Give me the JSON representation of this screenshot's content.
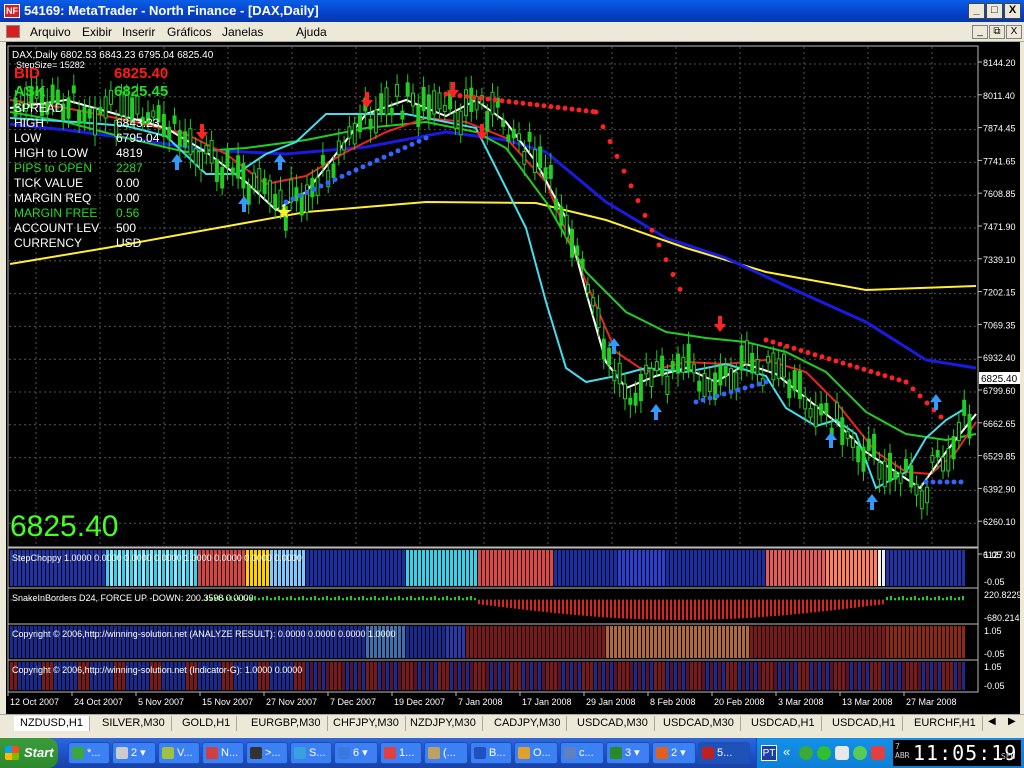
{
  "window": {
    "title": "54169: MetaTrader - North Finance - [DAX,Daily]",
    "app_icon": "NF",
    "controls": [
      "_",
      "□",
      "X"
    ],
    "mdi_controls": [
      "_",
      "⧉",
      "X"
    ]
  },
  "menu": [
    "Arquivo",
    "Exibir",
    "Inserir",
    "Gráficos",
    "Janelas",
    "Ajuda"
  ],
  "chart": {
    "symbol_line": "DAX,Daily  6802.53 6843.23 6795.04 6825.40",
    "stepsize": "StepSize= 15282",
    "current_price_label": "6825.40",
    "big_price": "6825.40",
    "info_panel": [
      {
        "label": "BID",
        "value": "6825.40",
        "color": "#ff1a1a"
      },
      {
        "label": "ASK",
        "value": "6825.45",
        "color": "#22dd22"
      },
      {
        "label": "SPREAD",
        "value": "",
        "color": "#ffffff"
      },
      {
        "label": "HIGH",
        "value": "6843.23",
        "color": "#ffffff"
      },
      {
        "label": "LOW",
        "value": "6795.04",
        "color": "#ffffff"
      },
      {
        "label": "HIGH to LOW",
        "value": "4819",
        "color": "#ffffff"
      },
      {
        "label": "PIPS to OPEN",
        "value": "2287",
        "color": "#22dd22"
      },
      {
        "label": "TICK VALUE",
        "value": "0.00",
        "color": "#ffffff"
      },
      {
        "label": "MARGIN REQ",
        "value": "0.00",
        "color": "#ffffff"
      },
      {
        "label": "MARGIN FREE",
        "value": "0.56",
        "color": "#22dd22"
      },
      {
        "label": "ACCOUNT LEV",
        "value": "500",
        "color": "#ffffff"
      },
      {
        "label": "CURRENCY",
        "value": "USD",
        "color": "#ffffff"
      }
    ],
    "price_axis": [
      "8144.20",
      "8011.40",
      "7874.45",
      "7741.65",
      "7608.85",
      "7471.90",
      "7339.10",
      "7202.15",
      "7069.35",
      "6932.40",
      "6799.60",
      "6662.65",
      "6529.85",
      "6392.90",
      "6260.10",
      "6127.30"
    ],
    "date_axis": [
      "12 Oct 2007",
      "24 Oct 2007",
      "5 Nov 2007",
      "15 Nov 2007",
      "27 Nov 2007",
      "7 Dec 2007",
      "19 Dec 2007",
      "7 Jan 2008",
      "17 Jan 2008",
      "29 Jan 2008",
      "8 Feb 2008",
      "20 Feb 2008",
      "3 Mar 2008",
      "13 Mar 2008",
      "27 Mar 2008"
    ]
  },
  "subwindows": [
    {
      "label": "StepChoppy 1.0000 0.0000 0.0000 0.0000 1.0000 0.0000 0.0000 0.0000",
      "scale_top": "1.05",
      "scale_bottom": "-0.05"
    },
    {
      "label": "SnakeInBorders D24, FORCE UP -DOWN: 200.3598 0.0000",
      "scale_top": "220.8229",
      "scale_bottom": "-680.214"
    },
    {
      "label": "Copyright © 2006,http://winning-solution.net (ANALYZE RESULT): 0.0000 0.0000 0.0000 1.0000",
      "scale_top": "1.05",
      "scale_bottom": "-0.05"
    },
    {
      "label": "Copyright © 2006,http://winning-solution.net (Indicator-G): 1.0000 0.0000",
      "scale_top": "1.05",
      "scale_bottom": "-0.05"
    }
  ],
  "tabs": [
    "NZDUSD,H1",
    "SILVER,M30",
    "GOLD,H1",
    "EURGBP,M30",
    "CHFJPY,M30",
    "NZDJPY,M30",
    "CADJPY,M30",
    "USDCAD,M30",
    "USDCAD,M30",
    "USDCAD,H1",
    "USDCAD,H1",
    "EURCHF,H1"
  ],
  "taskbar": {
    "start_label": "Start",
    "buttons": [
      {
        "label": "*...",
        "color": "#3aa83a"
      },
      {
        "label": "2 ▾",
        "color": "#cccccc"
      },
      {
        "label": "V...",
        "color": "#a0c040"
      },
      {
        "label": "N...",
        "color": "#d04040"
      },
      {
        "label": ">...",
        "color": "#333333"
      },
      {
        "label": "S...",
        "color": "#3aa0e0"
      },
      {
        "label": "6 ▾",
        "color": "#3a78e0"
      },
      {
        "label": "1...",
        "color": "#e04040"
      },
      {
        "label": "(...",
        "color": "#c0a060"
      },
      {
        "label": "B...",
        "color": "#2050c0"
      },
      {
        "label": "O...",
        "color": "#e0a030"
      },
      {
        "label": "c...",
        "color": "#6080c0"
      },
      {
        "label": "3 ▾",
        "color": "#2a8a2a"
      },
      {
        "label": "2 ▾",
        "color": "#e06020"
      },
      {
        "label": "5...",
        "color": "#c02020"
      }
    ],
    "lang": "PT",
    "date_small": "7 ABR",
    "clock": "11:05:19",
    "clock_suffix": "SEG"
  }
}
